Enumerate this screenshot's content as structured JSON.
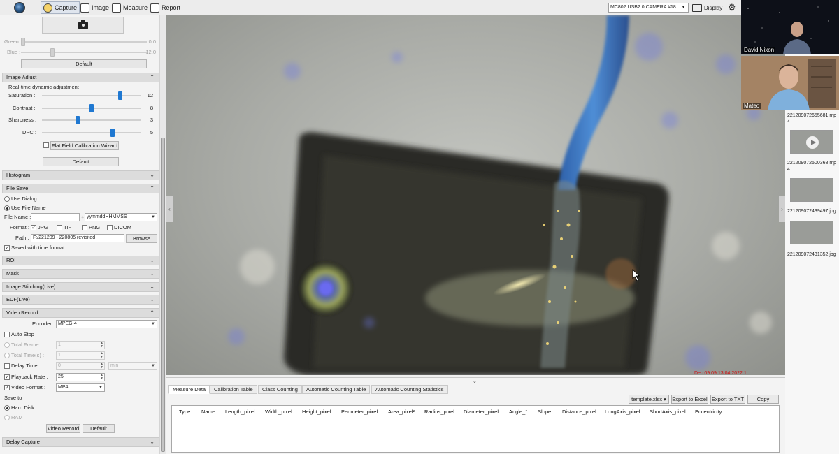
{
  "toolbar": {
    "tabs": [
      {
        "label": "Capture",
        "icon": "capture-icon",
        "active": true
      },
      {
        "label": "Image",
        "icon": "image-icon",
        "active": false
      },
      {
        "label": "Measure",
        "icon": "measure-icon",
        "active": false
      },
      {
        "label": "Report",
        "icon": "report-icon",
        "active": false
      }
    ],
    "camera_select": "MC802 USB2.0 CAMERA #18",
    "display_label": "Display"
  },
  "left": {
    "color": {
      "green_label": "Green :",
      "green_value": "0.0",
      "blue_label": "Blue :",
      "blue_value": "12.0",
      "default_label": "Default"
    },
    "image_adjust": {
      "title": "Image Adjust",
      "realtime_label": "Real-time dynamic adjustment",
      "saturation_label": "Saturation :",
      "saturation_value": "12",
      "saturation_level": 0.8,
      "contrast_label": "Contrast :",
      "contrast_value": "8",
      "contrast_level": 0.5,
      "sharpness_label": "Sharpness :",
      "sharpness_value": "3",
      "sharpness_level": 0.35,
      "dpc_label": "DPC :",
      "dpc_value": "5",
      "dpc_level": 0.72,
      "flat_field_label": "Flat Field Calibration Wizard",
      "default_label": "Default"
    },
    "histogram": "Histogram",
    "file_save": {
      "title": "File Save",
      "use_dialog": "Use Dialog",
      "use_file_name": "Use File Name",
      "file_name_label": "File Name :",
      "file_name_value": "",
      "plus": "+",
      "format_pattern": "yymmddHHMMSS",
      "format_label": "Format :",
      "jpg": "JPG",
      "tif": "TIF",
      "png": "PNG",
      "dicom": "DICOM",
      "path_label": "Path :",
      "path_value": "F:/221209 - 220805 revisited",
      "browse_label": "Browse",
      "saved_time_label": "Saved with time format"
    },
    "roi": "ROI",
    "mask": "Mask",
    "stitching": "Image Stitching(Live)",
    "edf": "EDF(Live)",
    "video_record": {
      "title": "Video Record",
      "encoder_label": "Encoder :",
      "encoder_value": "MPEG-4",
      "auto_stop": "Auto Stop",
      "total_frame_label": "Total Frame :",
      "total_frame_value": "1",
      "total_time_label": "Total Time(s) :",
      "total_time_value": "1",
      "delay_time_label": "Delay Time :",
      "delay_time_value": "0",
      "delay_unit": "min",
      "playback_label": "Playback Rate :",
      "playback_value": "25",
      "video_format_label": "Video Format :",
      "video_format_value": "MP4",
      "save_to_label": "Save to :",
      "hard_disk": "Hard Disk",
      "ram": "RAM",
      "video_record_btn": "Video Record",
      "default_btn": "Default"
    },
    "delay_capture": "Delay Capture"
  },
  "measure": {
    "tabs": [
      "Measure Data",
      "Calibration Table",
      "Class Counting",
      "Automatic Counting Table",
      "Automatic Counting Statistics"
    ],
    "template_select": "template.xlsx",
    "export_excel": "Export to Excel",
    "export_txt": "Export to TXT",
    "copy": "Copy",
    "columns": [
      "Type",
      "Name",
      "Length_pixel",
      "Width_pixel",
      "Height_pixel",
      "Perimeter_pixel",
      "Area_pixel²",
      "Radius_pixel",
      "Diameter_pixel",
      "Angle_°",
      "Slope",
      "Distance_pixel",
      "LongAxis_pixel",
      "ShortAxis_pixel",
      "Eccentricity"
    ]
  },
  "participants": [
    {
      "name": "David Nixon"
    },
    {
      "name": "Mateo"
    }
  ],
  "files": [
    "221209072655681.mp4",
    "221209072500368.mp4",
    "221209072439497.jpg",
    "221209072431352.jpg"
  ],
  "overlay_timestamp": "Dec 09 09:13:04 2022 1"
}
